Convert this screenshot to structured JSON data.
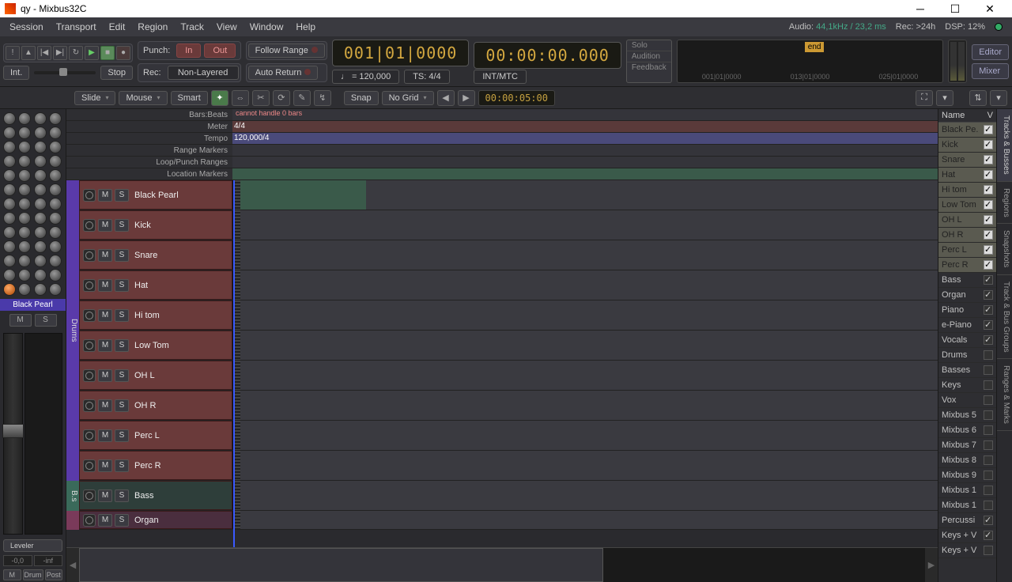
{
  "title": "qy - Mixbus32C",
  "menus": [
    "Session",
    "Transport",
    "Edit",
    "Region",
    "Track",
    "View",
    "Window",
    "Help"
  ],
  "status": {
    "audio_label": "Audio:",
    "audio_val": "44,1kHz / 23,2 ms",
    "rec": "Rec: >24h",
    "dsp": "DSP: 12%"
  },
  "transport": {
    "int": "Int.",
    "stop": "Stop",
    "punch": "Punch:",
    "in": "In",
    "out": "Out",
    "rec": "Rec:",
    "mode": "Non-Layered",
    "follow": "Follow Range",
    "autoreturn": "Auto Return",
    "tempo": "♩ = 120,000",
    "ts": "TS: 4/4",
    "sync": "INT/MTC",
    "bigtime1": "001|01|0000",
    "bigtime2": "00:00:00.000",
    "side": [
      "Solo",
      "Audition",
      "Feedback"
    ],
    "endflag": "end",
    "timeline": [
      "001|01|0000",
      "013|01|0000",
      "025|01|0000"
    ],
    "editor": "Editor",
    "mixer": "Mixer"
  },
  "toolbar": {
    "slide": "Slide",
    "mouse": "Mouse",
    "smart": "Smart",
    "snap": "Snap",
    "nogrid": "No Grid",
    "time": "00:00:05:00"
  },
  "rulers": {
    "barsbeats": "Bars:Beats",
    "barswarn": "cannot handle 0 bars",
    "meter": "Meter",
    "meterval": "4/4",
    "tempo": "Tempo",
    "tempoval": "120,000/4",
    "range": "Range Markers",
    "loop": "Loop/Punch Ranges",
    "loc": "Location Markers"
  },
  "mixstrip": {
    "name": "Black Pearl",
    "m": "M",
    "s": "S",
    "val1": "-0,0",
    "val2": "-inf",
    "modes": [
      "M",
      "Drum",
      "Post"
    ],
    "leveler": "Leveler"
  },
  "grouplabel": "Drums",
  "tracks": [
    {
      "name": "Black Pearl",
      "grp": "drums"
    },
    {
      "name": "Kick",
      "grp": "drums"
    },
    {
      "name": "Snare",
      "grp": "drums"
    },
    {
      "name": "Hat",
      "grp": "drums"
    },
    {
      "name": "Hi tom",
      "grp": "drums"
    },
    {
      "name": "Low Tom",
      "grp": "drums"
    },
    {
      "name": "OH L",
      "grp": "drums"
    },
    {
      "name": "OH R",
      "grp": "drums"
    },
    {
      "name": "Perc L",
      "grp": "drums"
    },
    {
      "name": "Perc R",
      "grp": "drums"
    },
    {
      "name": "Bass",
      "grp": "bass"
    },
    {
      "name": "Organ",
      "grp": "organ"
    }
  ],
  "rightpanel": {
    "header_name": "Name",
    "header_v": "V",
    "items": [
      {
        "n": "Black Pe.",
        "hi": true,
        "chk": true
      },
      {
        "n": "Kick",
        "hi": true,
        "chk": true
      },
      {
        "n": "Snare",
        "hi": true,
        "chk": true
      },
      {
        "n": "Hat",
        "hi": true,
        "chk": true
      },
      {
        "n": "Hi tom",
        "hi": true,
        "chk": true
      },
      {
        "n": "Low Tom",
        "hi": true,
        "chk": true
      },
      {
        "n": "OH L",
        "hi": true,
        "chk": true
      },
      {
        "n": "OH R",
        "hi": true,
        "chk": true
      },
      {
        "n": "Perc L",
        "hi": true,
        "chk": true
      },
      {
        "n": "Perc R",
        "hi": true,
        "chk": true
      },
      {
        "n": "Bass",
        "hi": false,
        "chk": true
      },
      {
        "n": "Organ",
        "hi": false,
        "chk": true
      },
      {
        "n": "Piano",
        "hi": false,
        "chk": true
      },
      {
        "n": "e-Piano",
        "hi": false,
        "chk": true
      },
      {
        "n": "Vocals",
        "hi": false,
        "chk": true
      },
      {
        "n": "Drums",
        "hi": false,
        "chk": false
      },
      {
        "n": "Basses",
        "hi": false,
        "chk": false
      },
      {
        "n": "Keys",
        "hi": false,
        "chk": false
      },
      {
        "n": "Vox",
        "hi": false,
        "chk": false
      },
      {
        "n": "Mixbus 5",
        "hi": false,
        "chk": false
      },
      {
        "n": "Mixbus 6",
        "hi": false,
        "chk": false
      },
      {
        "n": "Mixbus 7",
        "hi": false,
        "chk": false
      },
      {
        "n": "Mixbus 8",
        "hi": false,
        "chk": false
      },
      {
        "n": "Mixbus 9",
        "hi": false,
        "chk": false
      },
      {
        "n": "Mixbus 1",
        "hi": false,
        "chk": false
      },
      {
        "n": "Mixbus 1",
        "hi": false,
        "chk": false
      },
      {
        "n": "Percussi",
        "hi": false,
        "chk": true
      },
      {
        "n": "Keys + V",
        "hi": false,
        "chk": true
      },
      {
        "n": "Keys + V",
        "hi": false,
        "chk": false
      }
    ]
  },
  "vtabs": [
    "Tracks & Busses",
    "Regions",
    "Snapshots",
    "Track & Bus Groups",
    "Ranges & Marks"
  ]
}
